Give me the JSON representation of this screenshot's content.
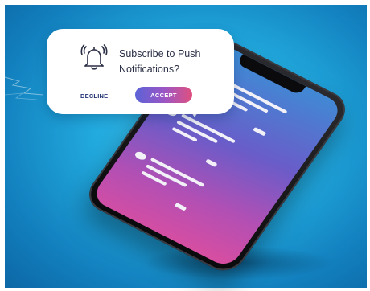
{
  "dialog": {
    "title": "Subscribe to Push Notifications?",
    "decline_label": "DECLINE",
    "accept_label": "ACCEPT",
    "icon": "bell-icon"
  },
  "colors": {
    "background": "#1f9fd9",
    "accent_start": "#5b63d6",
    "accent_end": "#e0507f",
    "decline_text": "#243574"
  },
  "phone": {
    "messages": [
      {
        "name": "message-1",
        "has_dot": false
      },
      {
        "name": "message-2",
        "has_dot": true
      },
      {
        "name": "message-3",
        "has_dot": true
      }
    ]
  }
}
